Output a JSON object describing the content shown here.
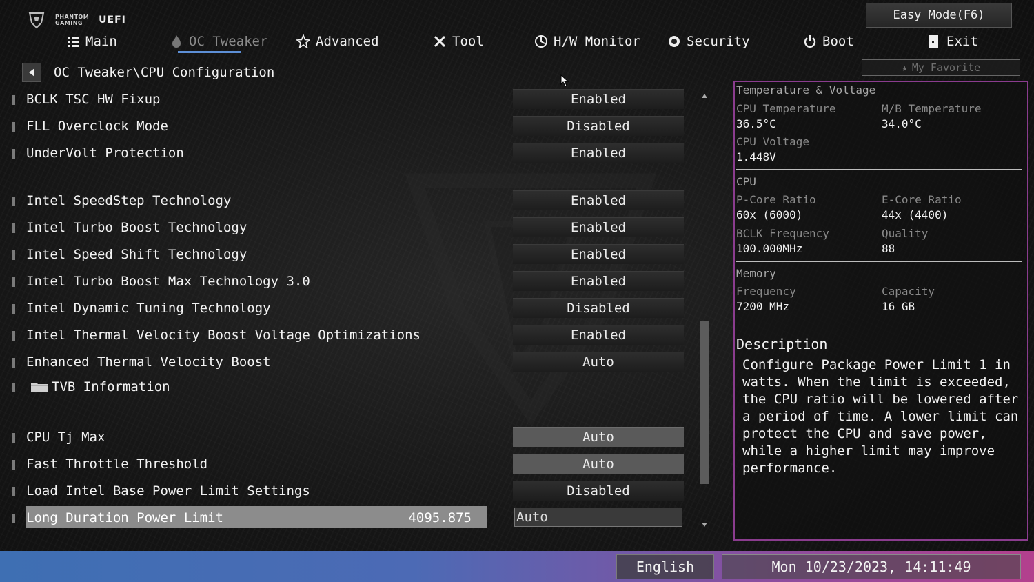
{
  "brand": {
    "line1": "PHANTOM",
    "line2": "GAMING",
    "uefi": "UEFI"
  },
  "easy_mode_label": "Easy Mode(F6)",
  "nav": [
    {
      "label": "Main",
      "icon": "list-icon"
    },
    {
      "label": "OC Tweaker",
      "icon": "flame-icon",
      "active": true
    },
    {
      "label": "Advanced",
      "icon": "star-icon"
    },
    {
      "label": "Tool",
      "icon": "wrench-icon"
    },
    {
      "label": "H/W Monitor",
      "icon": "monitor-icon"
    },
    {
      "label": "Security",
      "icon": "shield-icon"
    },
    {
      "label": "Boot",
      "icon": "power-icon"
    },
    {
      "label": "Exit",
      "icon": "exit-icon"
    }
  ],
  "breadcrumb": "OC Tweaker\\CPU Configuration",
  "favorite_label": "My Favorite",
  "settings": [
    {
      "label": "BCLK TSC HW Fixup",
      "value": "Enabled"
    },
    {
      "label": "FLL Overclock Mode",
      "value": "Disabled"
    },
    {
      "label": "UnderVolt Protection",
      "value": "Enabled"
    },
    {
      "label": "Intel SpeedStep Technology",
      "value": "Enabled"
    },
    {
      "label": "Intel Turbo Boost Technology",
      "value": "Enabled"
    },
    {
      "label": "Intel Speed Shift Technology",
      "value": "Enabled"
    },
    {
      "label": "Intel Turbo Boost Max Technology 3.0",
      "value": "Enabled"
    },
    {
      "label": "Intel Dynamic Tuning Technology",
      "value": "Disabled"
    },
    {
      "label": "Intel Thermal Velocity Boost Voltage Optimizations",
      "value": "Enabled"
    },
    {
      "label": "Enhanced Thermal Velocity Boost",
      "value": "Auto"
    },
    {
      "label": "TVB Information"
    },
    {
      "label": "CPU Tj Max",
      "value": "Auto"
    },
    {
      "label": "Fast Throttle Threshold",
      "value": "Auto"
    },
    {
      "label": "Load Intel Base Power Limit Settings",
      "value": "Disabled"
    },
    {
      "label": "Long Duration Power Limit",
      "current": "4095.875",
      "value": "Auto"
    }
  ],
  "panel": {
    "tv_title": "Temperature & Voltage",
    "cpu_temp_label": "CPU Temperature",
    "cpu_temp": "36.5°C",
    "mb_temp_label": "M/B Temperature",
    "mb_temp": "34.0°C",
    "cpu_volt_label": "CPU Voltage",
    "cpu_volt": "1.448V",
    "cpu_title": "CPU",
    "pcore_label": "P-Core Ratio",
    "pcore": "60x (6000)",
    "ecore_label": "E-Core Ratio",
    "ecore": "44x (4400)",
    "bclk_label": "BCLK Frequency",
    "bclk": "100.000MHz",
    "quality_label": "Quality",
    "quality": "88",
    "mem_title": "Memory",
    "freq_label": "Frequency",
    "freq": "7200 MHz",
    "cap_label": "Capacity",
    "cap": "16 GB",
    "desc_title": "Description",
    "desc": "Configure Package Power Limit 1 in watts. When the limit is exceeded, the CPU ratio will be lowered after a period of time. A lower limit can protect the CPU and save power, while a higher limit may improve performance."
  },
  "footer": {
    "language": "English",
    "datetime": "Mon 10/23/2023, 14:11:49"
  },
  "colors": {
    "accent_blue": "#5d8fd6",
    "panel_border": "#8a3c8e"
  }
}
